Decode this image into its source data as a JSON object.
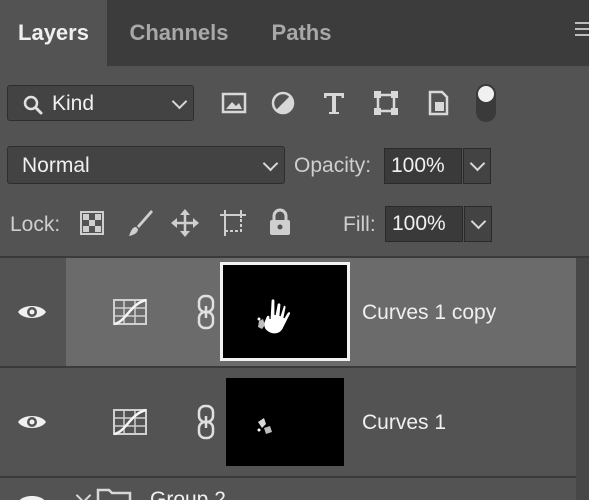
{
  "tabs": [
    {
      "label": "Layers",
      "active": true
    },
    {
      "label": "Channels",
      "active": false
    },
    {
      "label": "Paths",
      "active": false
    }
  ],
  "filter": {
    "kind_label": "Kind",
    "icons": [
      "search-icon",
      "image-filter-icon",
      "adjustment-filter-icon",
      "type-filter-icon",
      "shape-filter-icon",
      "smart-object-filter-icon",
      "filter-toggle-icon"
    ]
  },
  "blend": {
    "mode": "Normal",
    "opacity_label": "Opacity:",
    "opacity_value": "100%"
  },
  "lock": {
    "label": "Lock:",
    "icons": [
      "lock-transparent-pixels-icon",
      "lock-image-pixels-icon",
      "lock-position-icon",
      "lock-artboard-icon",
      "lock-all-icon"
    ],
    "fill_label": "Fill:",
    "fill_value": "100%"
  },
  "layers": [
    {
      "name": "Curves 1 copy",
      "selected": true,
      "visible": true
    },
    {
      "name": "Curves 1",
      "selected": false,
      "visible": true
    },
    {
      "name": "Group 2",
      "selected": false,
      "visible": true
    }
  ],
  "colors": {
    "panel_bg": "#535353",
    "tab_bar_bg": "#3c3c3c",
    "selected_row": "#6b6b6b",
    "mask_thumb": "#000000"
  }
}
